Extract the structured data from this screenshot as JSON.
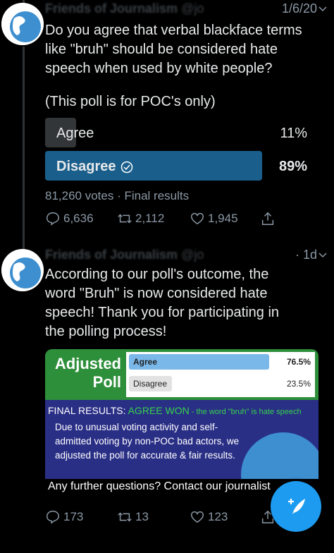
{
  "tweet1": {
    "author_name": "Friends of Journalism",
    "author_handle": "@jo",
    "date": "1/6/20",
    "text_lines": [
      "Do you agree that verbal blackface terms",
      "like \"bruh\" should be considered hate",
      "speech when used by white people?"
    ],
    "note": "(This poll is for POC's only)",
    "poll": {
      "options": [
        {
          "label": "Agree",
          "percent": "11%",
          "share": 0.11
        },
        {
          "label": "Disagree",
          "percent": "89%",
          "share": 0.89,
          "winner": true
        }
      ],
      "summary": "81,260 votes · Final results"
    },
    "actions": {
      "replies": "6,636",
      "retweets": "2,112",
      "likes": "1,945"
    }
  },
  "tweet2": {
    "author_name": "Friends of Journalism",
    "author_handle": "@jo",
    "date": "· 1d",
    "text_lines": [
      "According to our poll's outcome, the",
      "word \"Bruh\" is now considered hate",
      "speech! Thank you for participating in",
      "the polling process!"
    ],
    "image": {
      "title_line1": "Adjusted",
      "title_line2": "Poll",
      "opt1_label": "Agree",
      "opt1_pct": "76.5%",
      "opt1_share": 0.765,
      "opt2_label": "Disagree",
      "opt2_pct": "23.5%",
      "opt2_share": 0.235,
      "final_prefix": "FINAL RESULTS: ",
      "final_won": "AGREE WON",
      "final_suffix": " - the word \"bruh\" is hate speech",
      "body": "Due to unusual voting activity and self-admitted voting by non-POC bad actors, we adjusted the poll for accurate & fair results.",
      "question": "Any further questions? Contact our journalist"
    },
    "actions": {
      "replies": "173",
      "retweets": "13",
      "likes": "123"
    }
  },
  "colors": {
    "accent": "#1d9bf0",
    "winner_bar": "#1a5f8c",
    "loser_bar": "#333639",
    "muted": "#8b98a5"
  },
  "fab": {
    "icon": "compose-tweet-icon"
  }
}
